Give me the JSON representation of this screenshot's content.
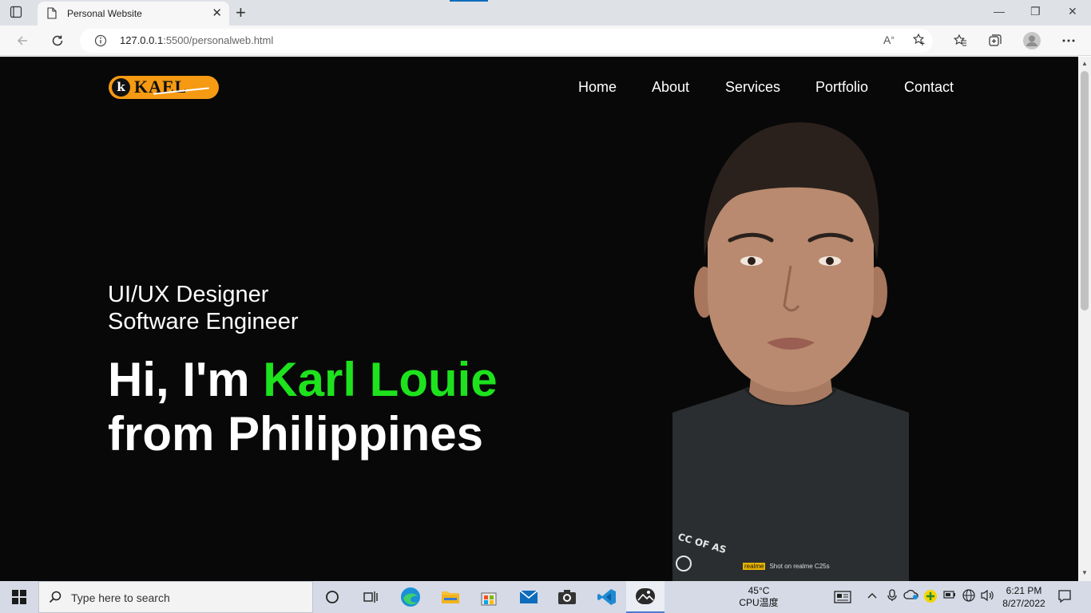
{
  "browser": {
    "tab_title": "Personal Website",
    "new_tab_symbol": "+",
    "close_tab_symbol": "✕",
    "url_host": "127.0.0.1",
    "url_rest": ":5500/personalweb.html",
    "read_aloud_label": "Aᴬ"
  },
  "site": {
    "logo_text": "KAEL",
    "logo_mark": "k",
    "nav": [
      "Home",
      "About",
      "Services",
      "Portfolio",
      "Contact"
    ],
    "subtitle_line1": "UI/UX Designer",
    "subtitle_line2": "Software Engineer",
    "hero_greeting": "Hi, I'm ",
    "hero_name": "Karl Louie",
    "hero_line2": "from Philippines",
    "photo_print": "CC OF AS",
    "watermark_brand": "realme",
    "watermark_text": "Shot on realme C25s"
  },
  "taskbar": {
    "search_placeholder": "Type here to search",
    "temperature": "45°C",
    "temp_label": "CPU温度",
    "time": "6:21 PM",
    "date": "8/27/2022"
  },
  "colors": {
    "page_bg": "#080808",
    "accent_name": "#1de21d",
    "logo_bg": "#f59a12"
  }
}
